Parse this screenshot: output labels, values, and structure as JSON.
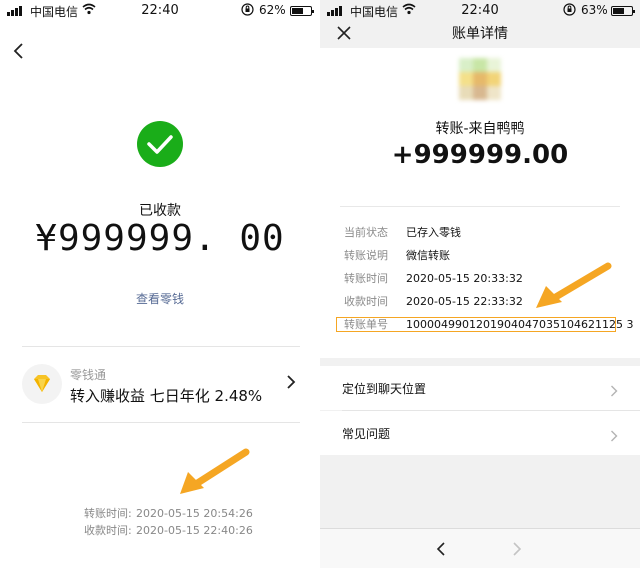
{
  "left": {
    "status": {
      "carrier": "中国电信",
      "time": "22:40",
      "battery_pct": "62%",
      "battery_level": 0.62
    },
    "received_label": "已收款",
    "amount": "¥999999. 00",
    "view_change_link": "查看零钱",
    "lqt": {
      "title": "零钱通",
      "subtitle": "转入赚收益 七日年化 2.48%"
    },
    "times": [
      {
        "label": "转账时间:",
        "value": "2020-05-15 20:54:26"
      },
      {
        "label": "收款时间:",
        "value": "2020-05-15 22:40:26"
      }
    ],
    "icons": {
      "back": "chevron-left-icon",
      "success": "check-circle-icon",
      "lqt": "diamond-icon",
      "more": "chevron-right-icon"
    },
    "colors": {
      "success": "#1aad19",
      "link": "#576b95",
      "annotation": "#f5a623"
    }
  },
  "right": {
    "status": {
      "carrier": "中国电信",
      "time": "22:40",
      "battery_pct": "63%",
      "battery_level": 0.63
    },
    "nav_title": "账单详情",
    "transfer_from": "转账-来自鸭鸭",
    "amount": "+999999.00",
    "details": [
      {
        "key": "当前状态",
        "value": "已存入零钱"
      },
      {
        "key": "转账说明",
        "value": "微信转账"
      },
      {
        "key": "转账时间",
        "value": "2020-05-15 20:33:32"
      },
      {
        "key": "收款时间",
        "value": "2020-05-15 22:33:32"
      },
      {
        "key": "转账单号",
        "value": "1000049901201904047035104621125 3"
      }
    ],
    "menu": [
      {
        "label": "定位到聊天位置"
      },
      {
        "label": "常见问题"
      }
    ],
    "icons": {
      "close": "close-icon",
      "back": "chevron-left-icon",
      "forward": "chevron-right-icon"
    }
  }
}
